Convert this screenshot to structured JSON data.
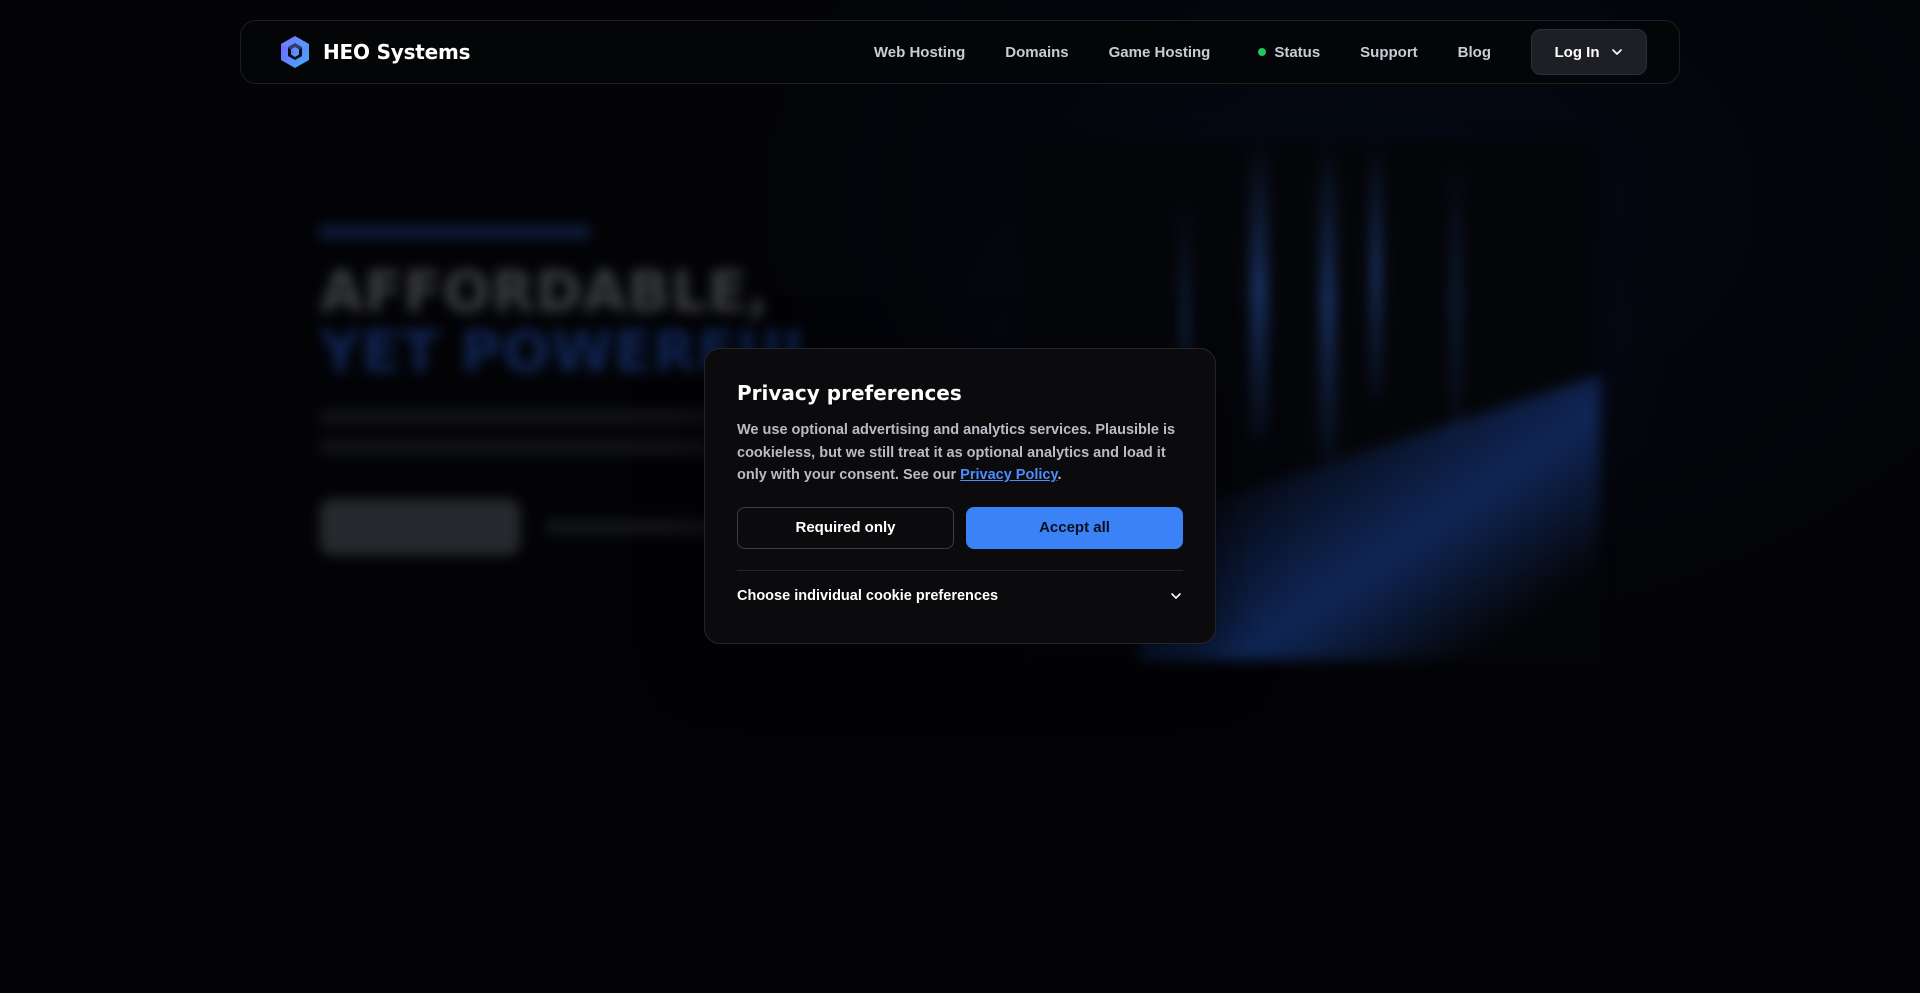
{
  "navbar": {
    "brand_name": "HEO Systems",
    "links": [
      {
        "label": "Web Hosting"
      },
      {
        "label": "Domains"
      },
      {
        "label": "Game Hosting"
      },
      {
        "label": "Status"
      },
      {
        "label": "Support"
      },
      {
        "label": "Blog"
      }
    ],
    "login_label": "Log In",
    "status_color": "#22c55e"
  },
  "hero": {
    "line1": "AFFORDABLE,",
    "line2": "YET POWERFUL"
  },
  "cookie_modal": {
    "title": "Privacy preferences",
    "body_text": "We use optional advertising and analytics services. Plausible is cookieless, but we still treat it as optional analytics and load it only with your consent. See our ",
    "policy_link": "Privacy Policy",
    "body_suffix": ".",
    "required_label": "Required only",
    "accept_label": "Accept all",
    "prefs_label": "Choose individual cookie preferences"
  },
  "colors": {
    "accent": "#3b82f6",
    "link": "#4e8cff",
    "background": "#050609"
  },
  "icons": {
    "logo": "hexagon-cube-logo-icon",
    "login_chevron": "chevron-down-icon",
    "prefs_chevron": "chevron-down-icon"
  }
}
